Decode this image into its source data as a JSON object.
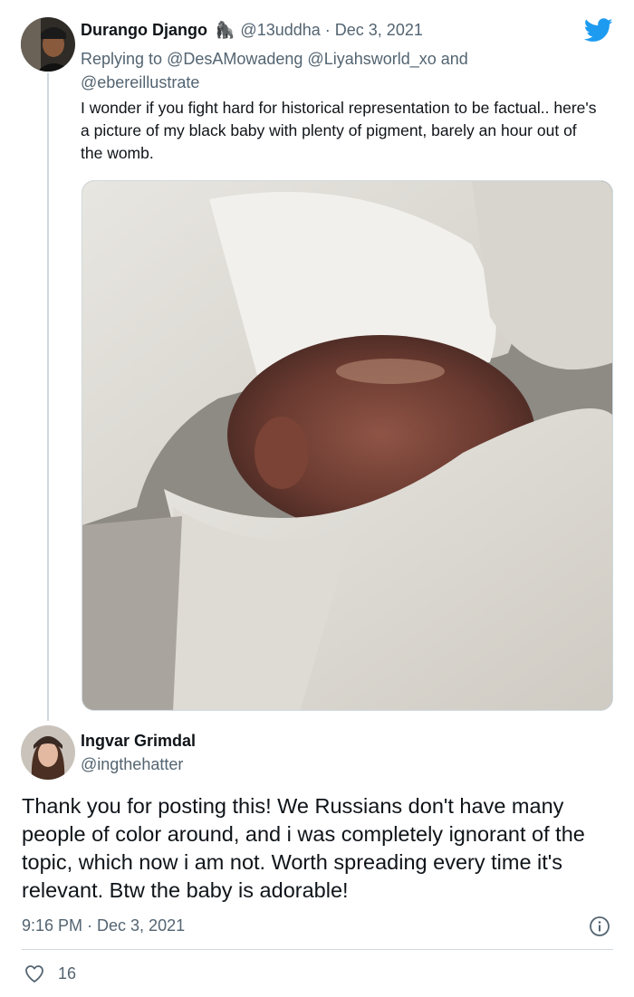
{
  "tweet1": {
    "display_name": "Durango Django",
    "emoji": "🦍",
    "handle": "@13uddha",
    "separator": "·",
    "date": "Dec 3, 2021",
    "reply_prefix": "Replying to",
    "reply_to": "@DesAMowadeng @Liyahsworld_xo",
    "reply_and": "and",
    "reply_to_last": "@ebereillustrate",
    "text": "I wonder if you fight hard for historical representation to be factual.. here's a picture of my black baby with plenty of pigment, barely an hour out of the womb.",
    "avatar_icon": "user-avatar-icon"
  },
  "tweet2": {
    "display_name": "Ingvar Grimdal",
    "handle": "@ingthehatter",
    "text": "Thank you for posting this! We Russians don't have many people of color around, and i was completely ignorant of the topic, which now i am not. Worth spreading every time it's relevant. Btw the baby is adorable!",
    "time": "9:16 PM · Dec 3, 2021",
    "like_count": "16"
  },
  "colors": {
    "twitter_blue": "#1d9bf0",
    "text": "#0f1419",
    "muted": "#536471",
    "divider": "#cfd9de"
  },
  "icons": [
    "twitter-bird-icon",
    "info-icon",
    "heart-icon"
  ]
}
